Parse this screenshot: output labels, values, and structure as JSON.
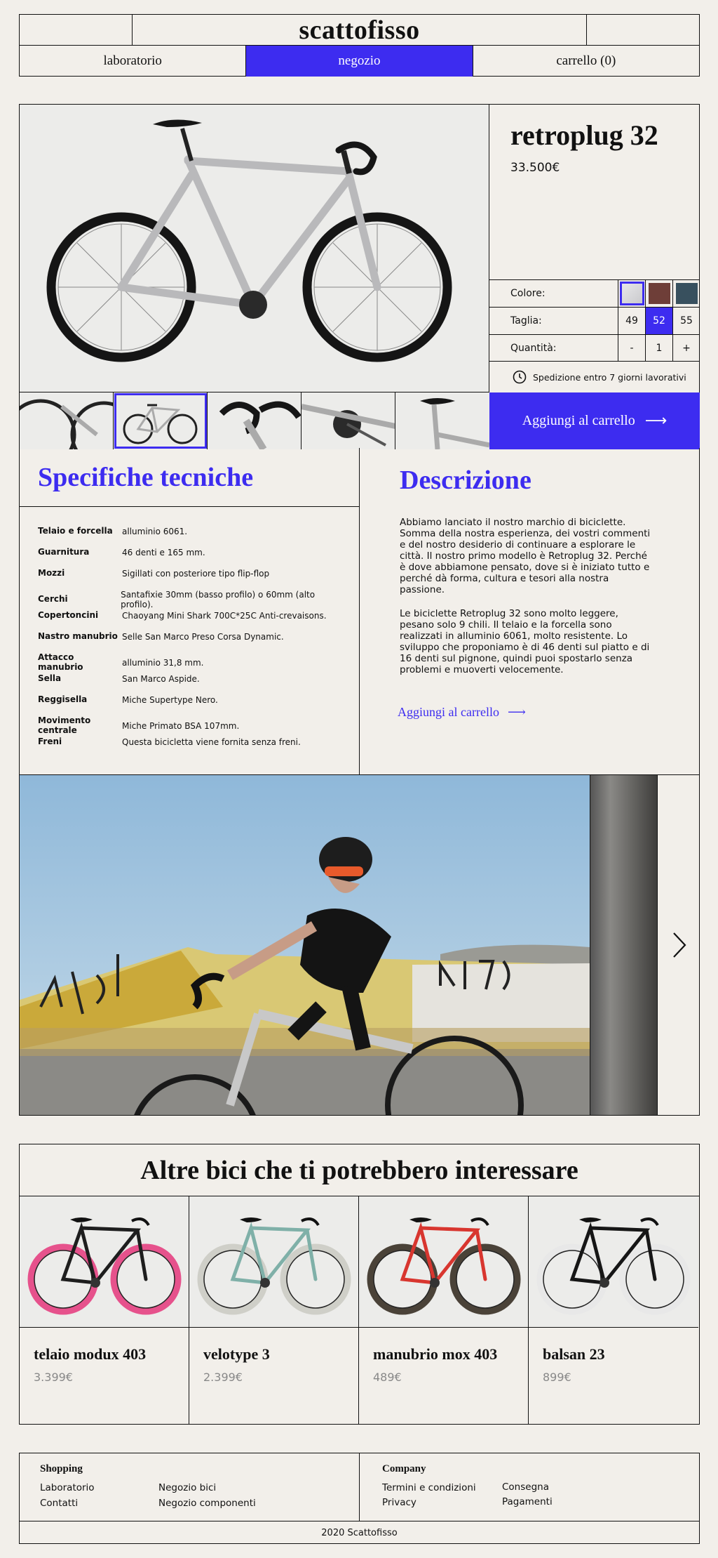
{
  "colors": {
    "accent": "#3d2cf0",
    "background": "#f2efea",
    "ink": "#111111"
  },
  "header": {
    "brand": "scattofisso",
    "nav": [
      {
        "label": "laboratorio",
        "active": false
      },
      {
        "label": "negozio",
        "active": true
      },
      {
        "label": "carrello (0)",
        "active": false
      }
    ]
  },
  "product": {
    "title": "retroplug 32",
    "price": "33.500€",
    "color_label": "Colore:",
    "colors": [
      "#c9c9cc",
      "#6e3e38",
      "#38505e"
    ],
    "size_label": "Taglia:",
    "sizes": [
      "49",
      "52",
      "55"
    ],
    "selected_size": "52",
    "qty_label": "Quantità:",
    "qty_minus": "-",
    "qty_value": "1",
    "qty_plus": "+",
    "shipping": "Spedizione entro 7 giorni lavorativi",
    "add_to_cart": "Aggiungi al carrello",
    "arrow": "⟶"
  },
  "specs": {
    "title": "Specifiche tecniche",
    "rows": [
      {
        "k": "Telaio e forcella",
        "v": "alluminio 6061."
      },
      {
        "k": "Guarnitura",
        "v": "46 denti e 165 mm."
      },
      {
        "k": "Mozzi",
        "v": "Sigillati con posteriore tipo flip-flop"
      },
      {
        "k": "Cerchi",
        "v": "Santafixie 30mm (basso profilo) o 60mm (alto profilo)."
      },
      {
        "k": "Copertoncini",
        "v": "Chaoyang Mini Shark 700C*25C Anti-crevaisons."
      },
      {
        "k": "Nastro manubrio",
        "v": "Selle San Marco Preso Corsa Dynamic."
      },
      {
        "k": "Attacco manubrio",
        "v": "alluminio 31,8 mm."
      },
      {
        "k": "Sella",
        "v": "San Marco Aspide."
      },
      {
        "k": "Reggisella",
        "v": "Miche Supertype Nero."
      },
      {
        "k": "Movimento centrale",
        "v": "Miche Primato BSA 107mm."
      },
      {
        "k": "Freni",
        "v": "Questa bicicletta viene fornita senza freni."
      }
    ]
  },
  "description": {
    "title": "Descrizione",
    "p1": "Abbiamo lanciato il nostro marchio di biciclette. Somma della nostra esperienza, dei vostri commenti e del nostro desiderio di continuare a esplorare le città. Il nostro primo modello è Retroplug 32. Perché è dove abbiamone pensato, dove si è iniziato tutto e perché dà forma, cultura e tesori alla nostra passione.",
    "p2": "Le biciclette Retroplug 32 sono molto leggere, pesano solo 9 chili. Il telaio e la forcella sono realizzati in alluminio 6061, molto resistente. Lo sviluppo che proponiamo è di 46 denti sul piatto e di 16 denti sul pignone, quindi puoi spostarlo senza problemi e muoverti velocemente.",
    "link": "Aggiungi al carrello"
  },
  "related": {
    "title": "Altre bici che ti potrebbero interessare",
    "items": [
      {
        "name": "telaio modux 403",
        "price": "3.399€",
        "frame": "#1e1e1e",
        "wheel": "#e6528c"
      },
      {
        "name": "velotype 3",
        "price": "2.399€",
        "frame": "#7fb0a8",
        "wheel": "#cfcfc8"
      },
      {
        "name": "manubrio mox 403",
        "price": "489€",
        "frame": "#d8362f",
        "wheel": "#4a4238"
      },
      {
        "name": "balsan 23",
        "price": "899€",
        "frame": "#161616",
        "wheel": "#e8e8e8"
      }
    ]
  },
  "footer": {
    "shopping_title": "Shopping",
    "shopping_links": [
      "Laboratorio",
      "Negozio bici",
      "Contatti",
      "Negozio componenti"
    ],
    "company_title": "Company",
    "company_links": [
      "Termini e condizioni",
      "Consegna",
      "Privacy",
      "Pagamenti"
    ],
    "copyright": "2020 Scattofisso"
  }
}
